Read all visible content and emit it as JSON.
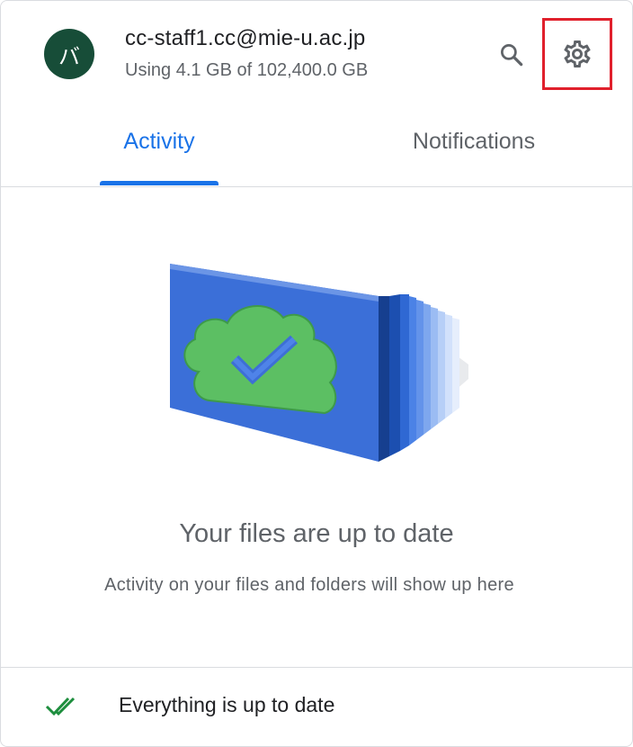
{
  "account": {
    "avatar_initial": "バ",
    "email": "cc-staff1.cc@mie-u.ac.jp",
    "storage": "Using 4.1 GB of 102,400.0 GB"
  },
  "header": {
    "search_icon": "search-icon",
    "settings_icon": "gear-icon"
  },
  "tabs": [
    {
      "label": "Activity",
      "selected": true
    },
    {
      "label": "Notifications",
      "selected": false
    }
  ],
  "empty_state": {
    "illustration": "cloud-check-illustration",
    "title": "Your files are up to date",
    "subtitle": "Activity on your files and folders will show up here"
  },
  "footer": {
    "status_icon": "double-check-icon",
    "status_text": "Everything is up to date"
  },
  "colors": {
    "accent": "#1a73e8",
    "avatar_bg": "#174d38",
    "highlight_box": "#e0202c",
    "check_green": "#1e8e3e"
  }
}
